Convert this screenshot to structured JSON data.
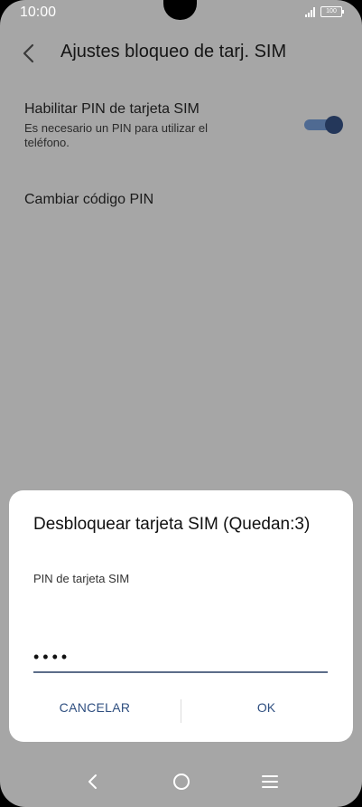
{
  "status_bar": {
    "time": "10:00",
    "battery": "100",
    "icons": [
      "signal-icon",
      "battery-icon"
    ]
  },
  "header": {
    "title": "Ajustes bloqueo de tarj. SIM",
    "back_icon": "back-arrow-icon"
  },
  "settings": {
    "enable_pin": {
      "title": "Habilitar PIN de tarjeta SIM",
      "description": "Es necesario un PIN para utilizar el teléfono.",
      "toggle_state": "on"
    },
    "change_pin": {
      "title": "Cambiar código PIN"
    }
  },
  "dialog": {
    "title": "Desbloquear tarjeta SIM (Quedan:3)",
    "label": "PIN de tarjeta SIM",
    "input_value": "••••",
    "cancel_label": "CANCELAR",
    "ok_label": "OK"
  },
  "nav_bar": {
    "icons": [
      "nav-back-icon",
      "nav-home-icon",
      "nav-menu-icon"
    ]
  },
  "colors": {
    "scrim_background": "#a6a6a6",
    "accent": "#2f4f80",
    "toggle_track": "#4f6a92",
    "toggle_knob": "#24375a"
  }
}
